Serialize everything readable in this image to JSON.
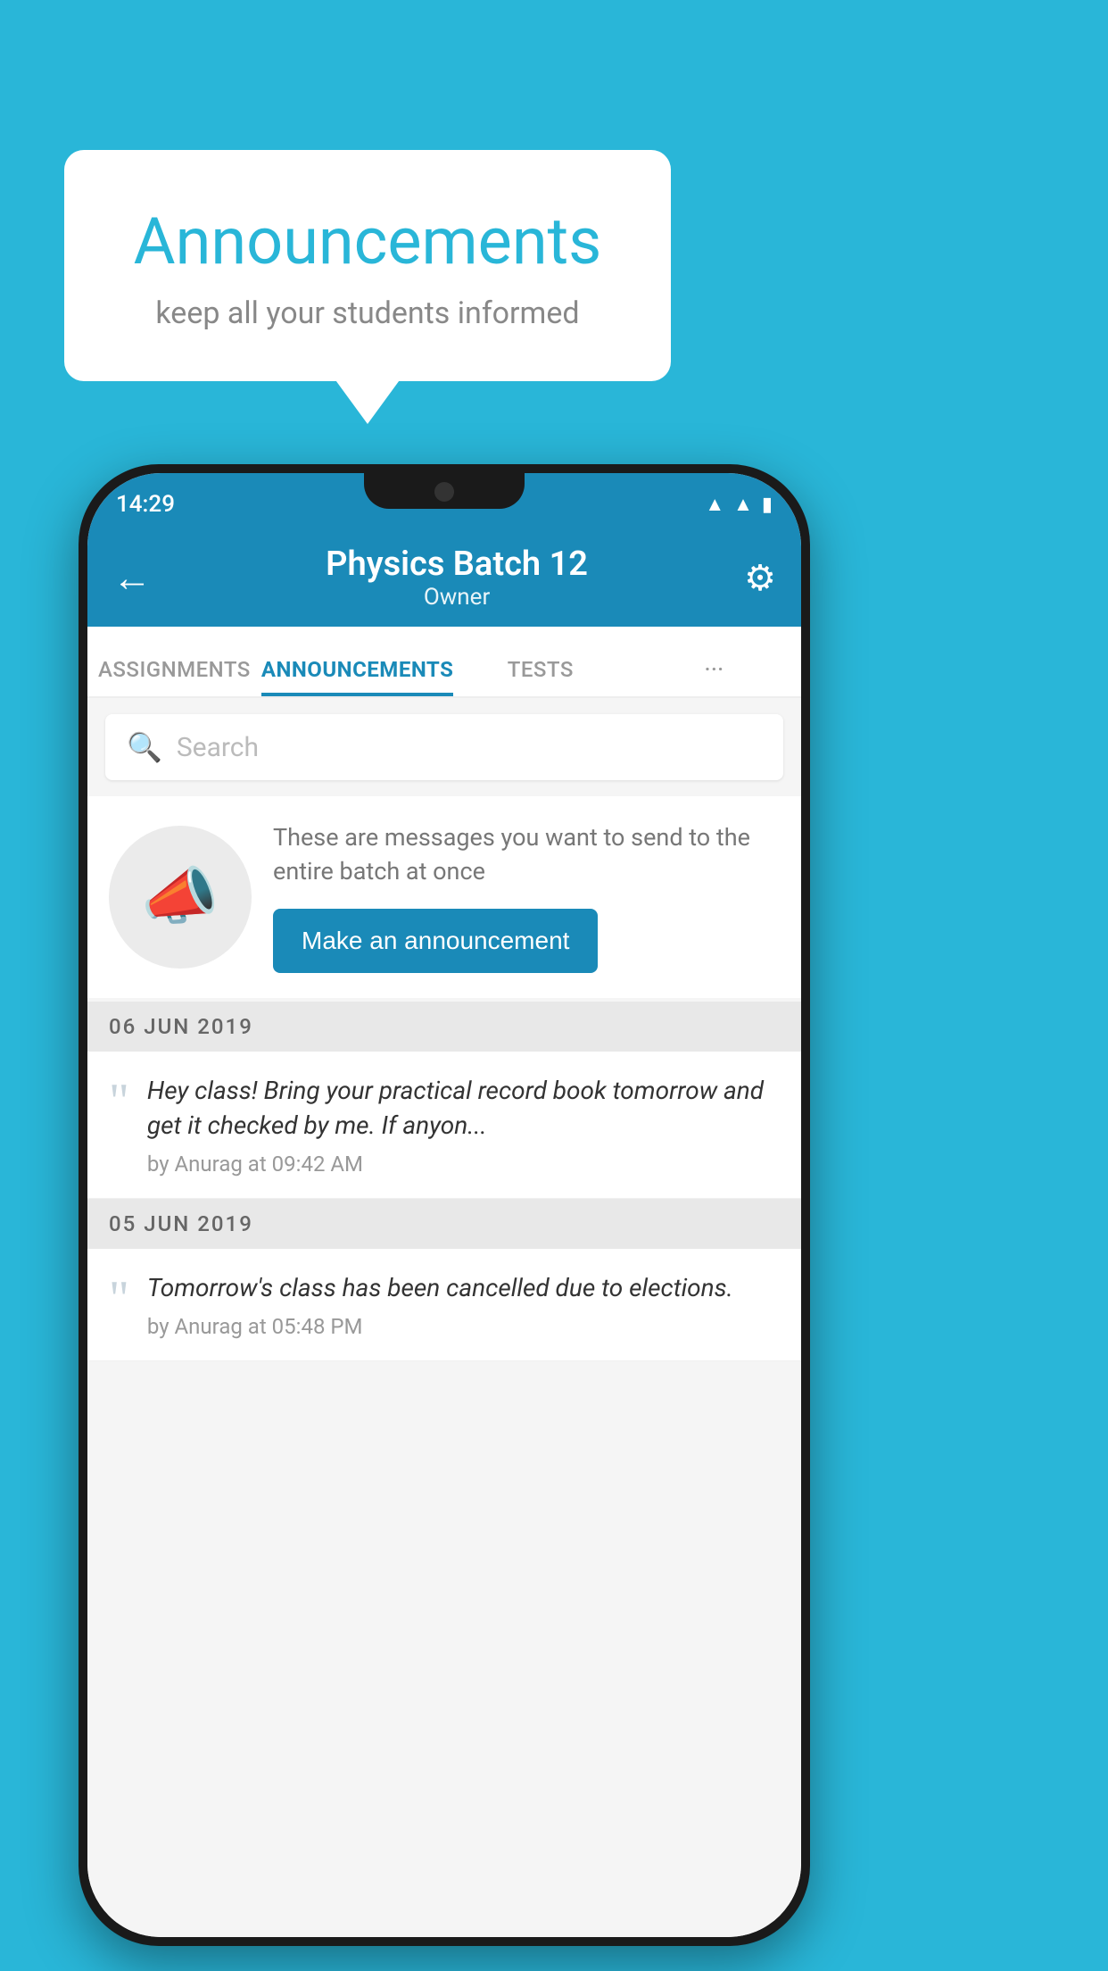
{
  "background_color": "#29b6d8",
  "speech_bubble": {
    "title": "Announcements",
    "subtitle": "keep all your students informed"
  },
  "phone": {
    "status_bar": {
      "time": "14:29",
      "icons": [
        "wifi",
        "signal",
        "battery"
      ]
    },
    "app_bar": {
      "title": "Physics Batch 12",
      "subtitle": "Owner",
      "back_label": "←",
      "settings_label": "⚙"
    },
    "tabs": [
      {
        "label": "ASSIGNMENTS",
        "active": false
      },
      {
        "label": "ANNOUNCEMENTS",
        "active": true
      },
      {
        "label": "TESTS",
        "active": false
      },
      {
        "label": "···",
        "active": false
      }
    ],
    "search": {
      "placeholder": "Search"
    },
    "promo": {
      "description": "These are messages you want to send to the entire batch at once",
      "button_label": "Make an announcement"
    },
    "announcements": [
      {
        "date": "06  JUN  2019",
        "message": "Hey class! Bring your practical record book tomorrow and get it checked by me. If anyon...",
        "meta": "by Anurag at 09:42 AM"
      },
      {
        "date": "05  JUN  2019",
        "message": "Tomorrow's class has been cancelled due to elections.",
        "meta": "by Anurag at 05:48 PM"
      }
    ]
  }
}
